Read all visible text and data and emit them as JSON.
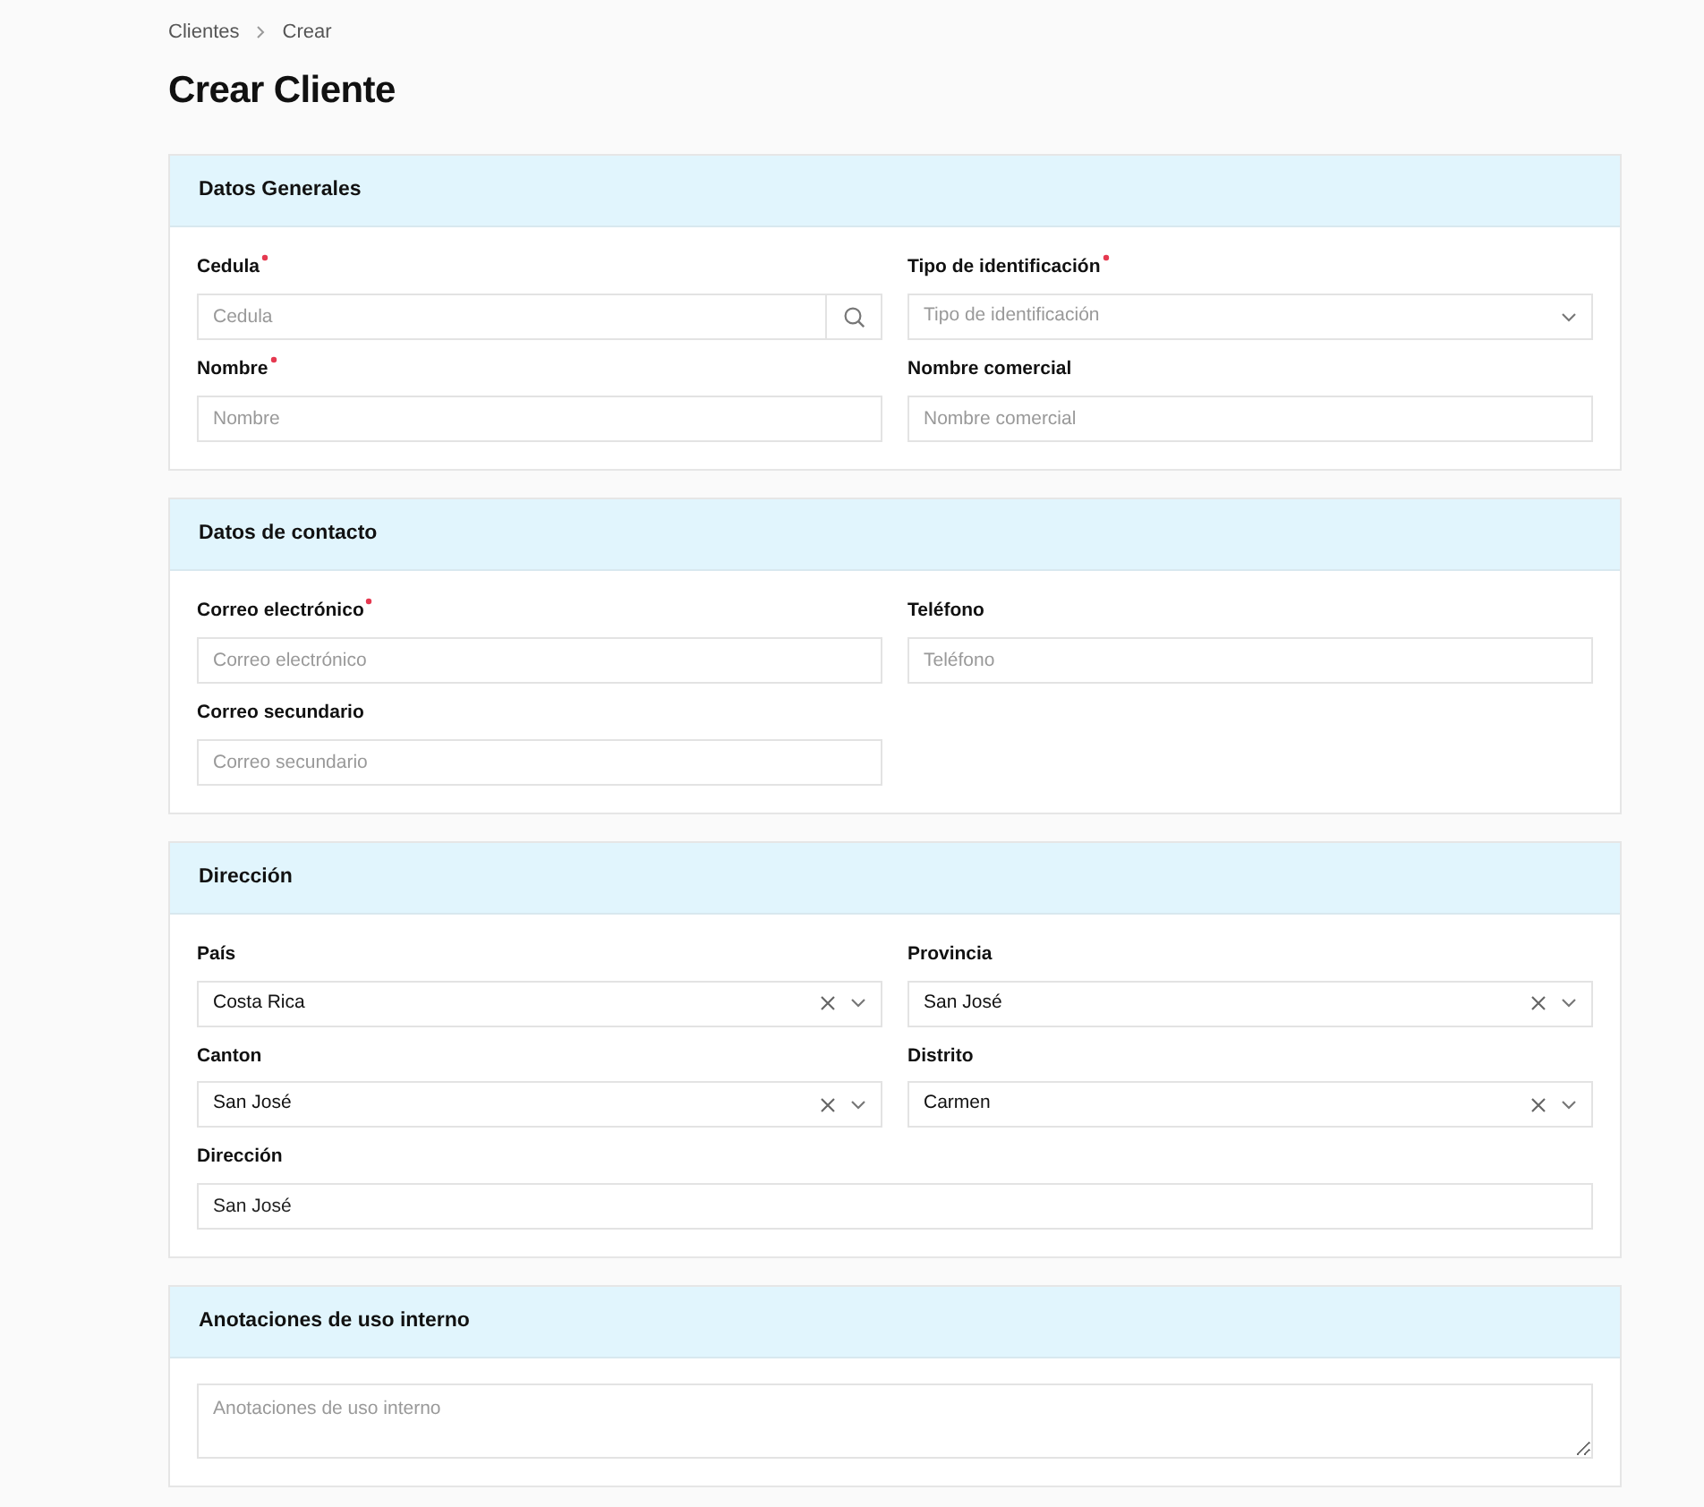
{
  "breadcrumb": [
    "Clientes",
    "Crear"
  ],
  "title": "Crear Cliente",
  "sections": [
    {
      "title": "Datos Generales",
      "fields": [
        {
          "kind": "search",
          "label": "Cedula",
          "required": true,
          "placeholder": "Cedula"
        },
        {
          "kind": "select",
          "label": "Tipo de identificación",
          "required": true,
          "placeholder": "Tipo de identificación"
        },
        {
          "kind": "text",
          "label": "Nombre",
          "required": true,
          "placeholder": "Nombre"
        },
        {
          "kind": "text",
          "label": "Nombre comercial",
          "required": false,
          "placeholder": "Nombre comercial"
        }
      ]
    },
    {
      "title": "Datos de contacto",
      "fields": [
        {
          "kind": "text",
          "label": "Correo electrónico",
          "required": true,
          "placeholder": "Correo electrónico"
        },
        {
          "kind": "text",
          "label": "Teléfono",
          "required": false,
          "placeholder": "Teléfono"
        },
        {
          "kind": "text",
          "label": "Correo secundario",
          "required": false,
          "placeholder": "Correo secundario"
        }
      ]
    },
    {
      "title": "Dirección",
      "fields": [
        {
          "kind": "select",
          "label": "País",
          "required": false,
          "value": "Costa Rica",
          "clearable": true
        },
        {
          "kind": "select",
          "label": "Provincia",
          "required": false,
          "value": "San José",
          "clearable": true
        },
        {
          "kind": "select",
          "label": "Canton",
          "required": false,
          "value": "San José",
          "clearable": true
        },
        {
          "kind": "select",
          "label": "Distrito",
          "required": false,
          "value": "Carmen",
          "clearable": true
        },
        {
          "kind": "text",
          "label": "Dirección",
          "required": false,
          "value": "San José",
          "wide": true
        }
      ]
    },
    {
      "title": "Anotaciones de uso interno",
      "fields": [
        {
          "kind": "textarea",
          "placeholder": "Anotaciones de uso interno",
          "wide": true
        }
      ]
    }
  ]
}
